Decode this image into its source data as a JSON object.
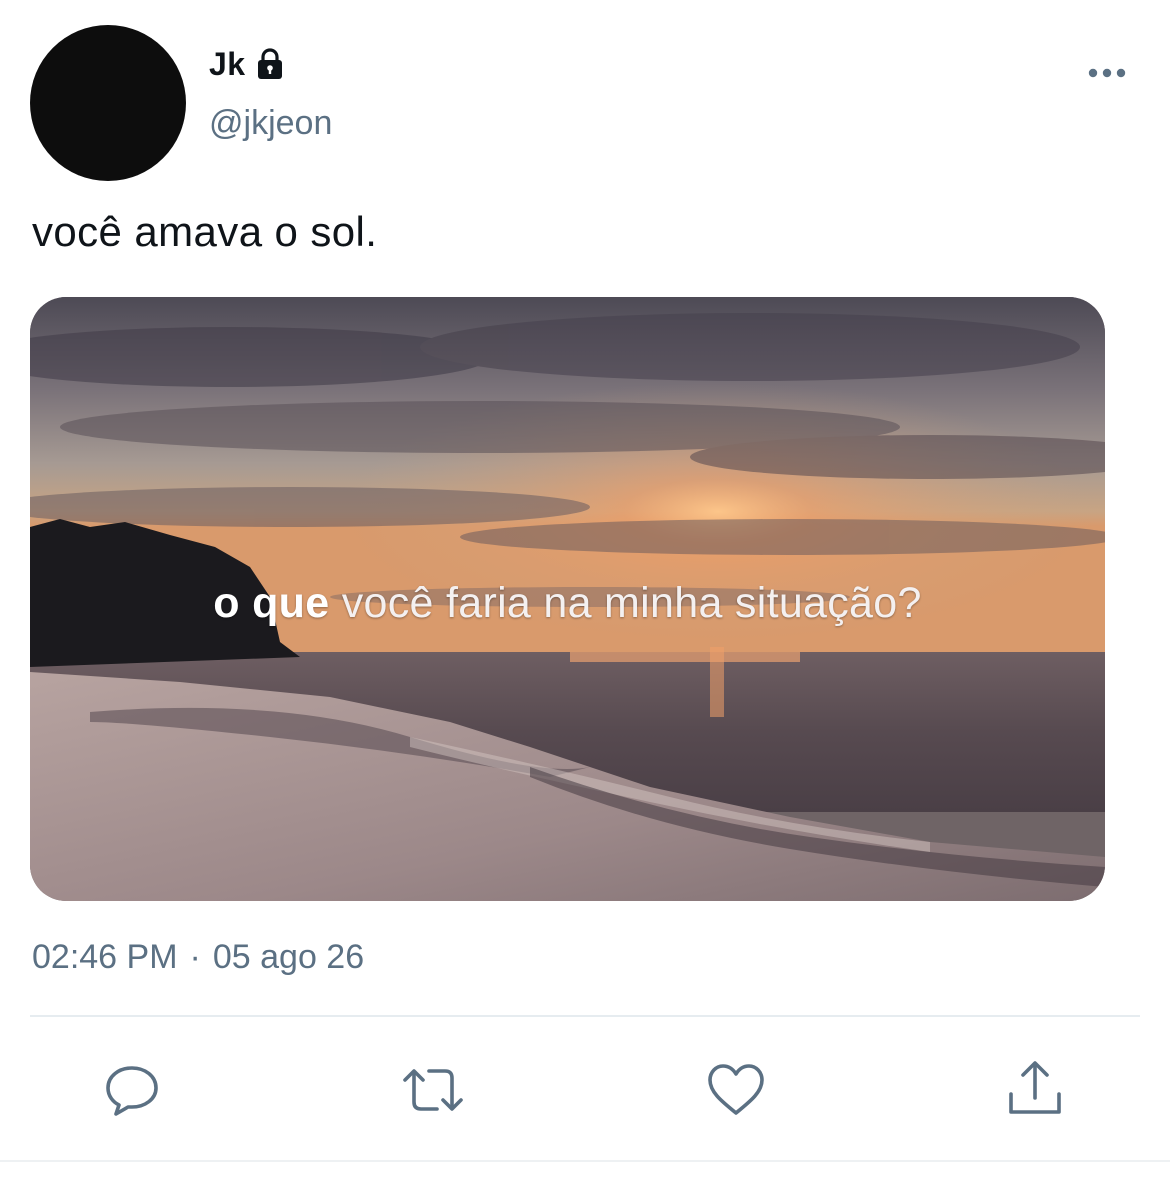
{
  "author": {
    "display_name": "Jk",
    "handle": "@jkjeon",
    "protected_icon": "lock-icon",
    "avatar_color": "#0d0d0d"
  },
  "menu": {
    "icon": "more-horizontal-icon"
  },
  "tweet": {
    "text": "você amava o sol.",
    "media": {
      "overlay_lead": "o que",
      "overlay_rest": " você faria na minha situação?",
      "scene": "sunset beach"
    },
    "time": "02:46 PM",
    "separator": "·",
    "date": "05 ago 26"
  },
  "actions": [
    {
      "name": "reply",
      "icon": "reply-icon"
    },
    {
      "name": "retweet",
      "icon": "retweet-icon"
    },
    {
      "name": "like",
      "icon": "heart-icon"
    },
    {
      "name": "share",
      "icon": "share-icon"
    }
  ],
  "colors": {
    "text_primary": "#0f1419",
    "text_secondary": "#5b7083",
    "icon_color": "#5b7083",
    "divider": "#e6ecf0"
  }
}
